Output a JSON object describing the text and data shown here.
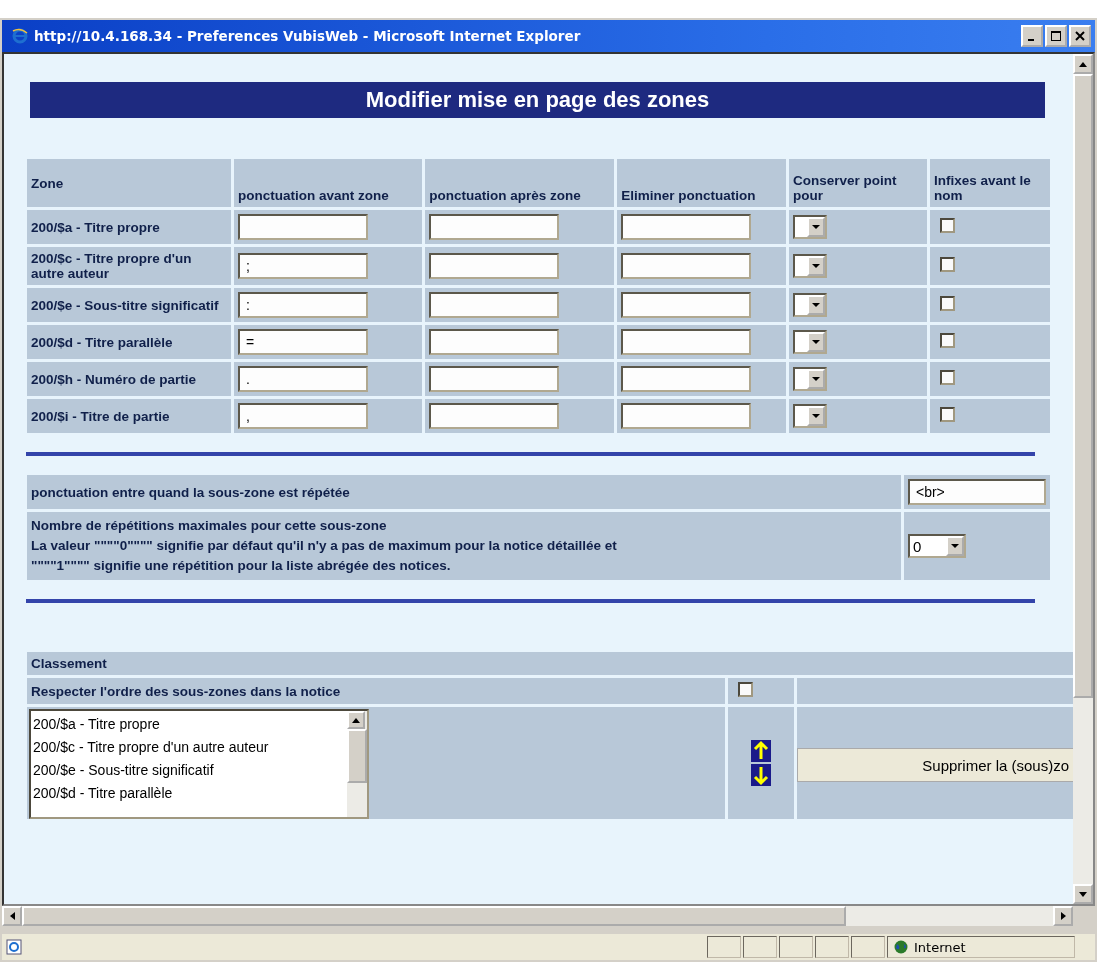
{
  "window": {
    "title": "http://10.4.168.34 - Preferences VubisWeb - Microsoft Internet Explorer"
  },
  "page_title": "Modifier mise en page des zones",
  "table": {
    "columns": [
      "Zone",
      "ponctuation avant zone",
      "ponctuation après zone",
      "Eliminer ponctuation",
      "Conserver point pour",
      "Infixes avant le nom"
    ],
    "rows": [
      {
        "zone": "200/$a - Titre propre",
        "checked": false
      },
      {
        "zone": "200/$c - Titre propre d'un autre auteur",
        "before": ";",
        "checked": false
      },
      {
        "zone": "200/$e - Sous-titre significatif",
        "before": ":",
        "checked": false
      },
      {
        "zone": "200/$d - Titre parallèle",
        "before": "=",
        "checked": false
      },
      {
        "zone": "200/$h - Numéro de partie",
        "before": ".",
        "checked": false
      },
      {
        "zone": "200/$i - Titre de partie",
        "before": ",",
        "checked": false
      }
    ]
  },
  "repeat_punctuation": {
    "label": "ponctuation entre quand la sous-zone est répétée",
    "value": "<br>"
  },
  "max_repetitions": {
    "lines": [
      "Nombre de répétitions maximales pour cette sous-zone",
      "La valeur \"\"\"\"0\"\"\"\" signifie par défaut qu'il n'y a pas de maximum pour la notice détaillée et",
      "\"\"\"\"1\"\"\"\" signifie une répétition pour la liste abrégée des notices."
    ],
    "value": "0"
  },
  "classement": {
    "heading": "Classement",
    "respect_order": {
      "label": "Respecter l'ordre des sous-zones dans la notice",
      "checked": false
    },
    "list_items": [
      "200/$a - Titre propre",
      "200/$c - Titre propre d'un autre auteur",
      "200/$e - Sous-titre significatif",
      "200/$d - Titre parallèle"
    ],
    "delete_button": "Supprimer la (sous)zo"
  },
  "status_bar": {
    "zone": "Internet"
  }
}
